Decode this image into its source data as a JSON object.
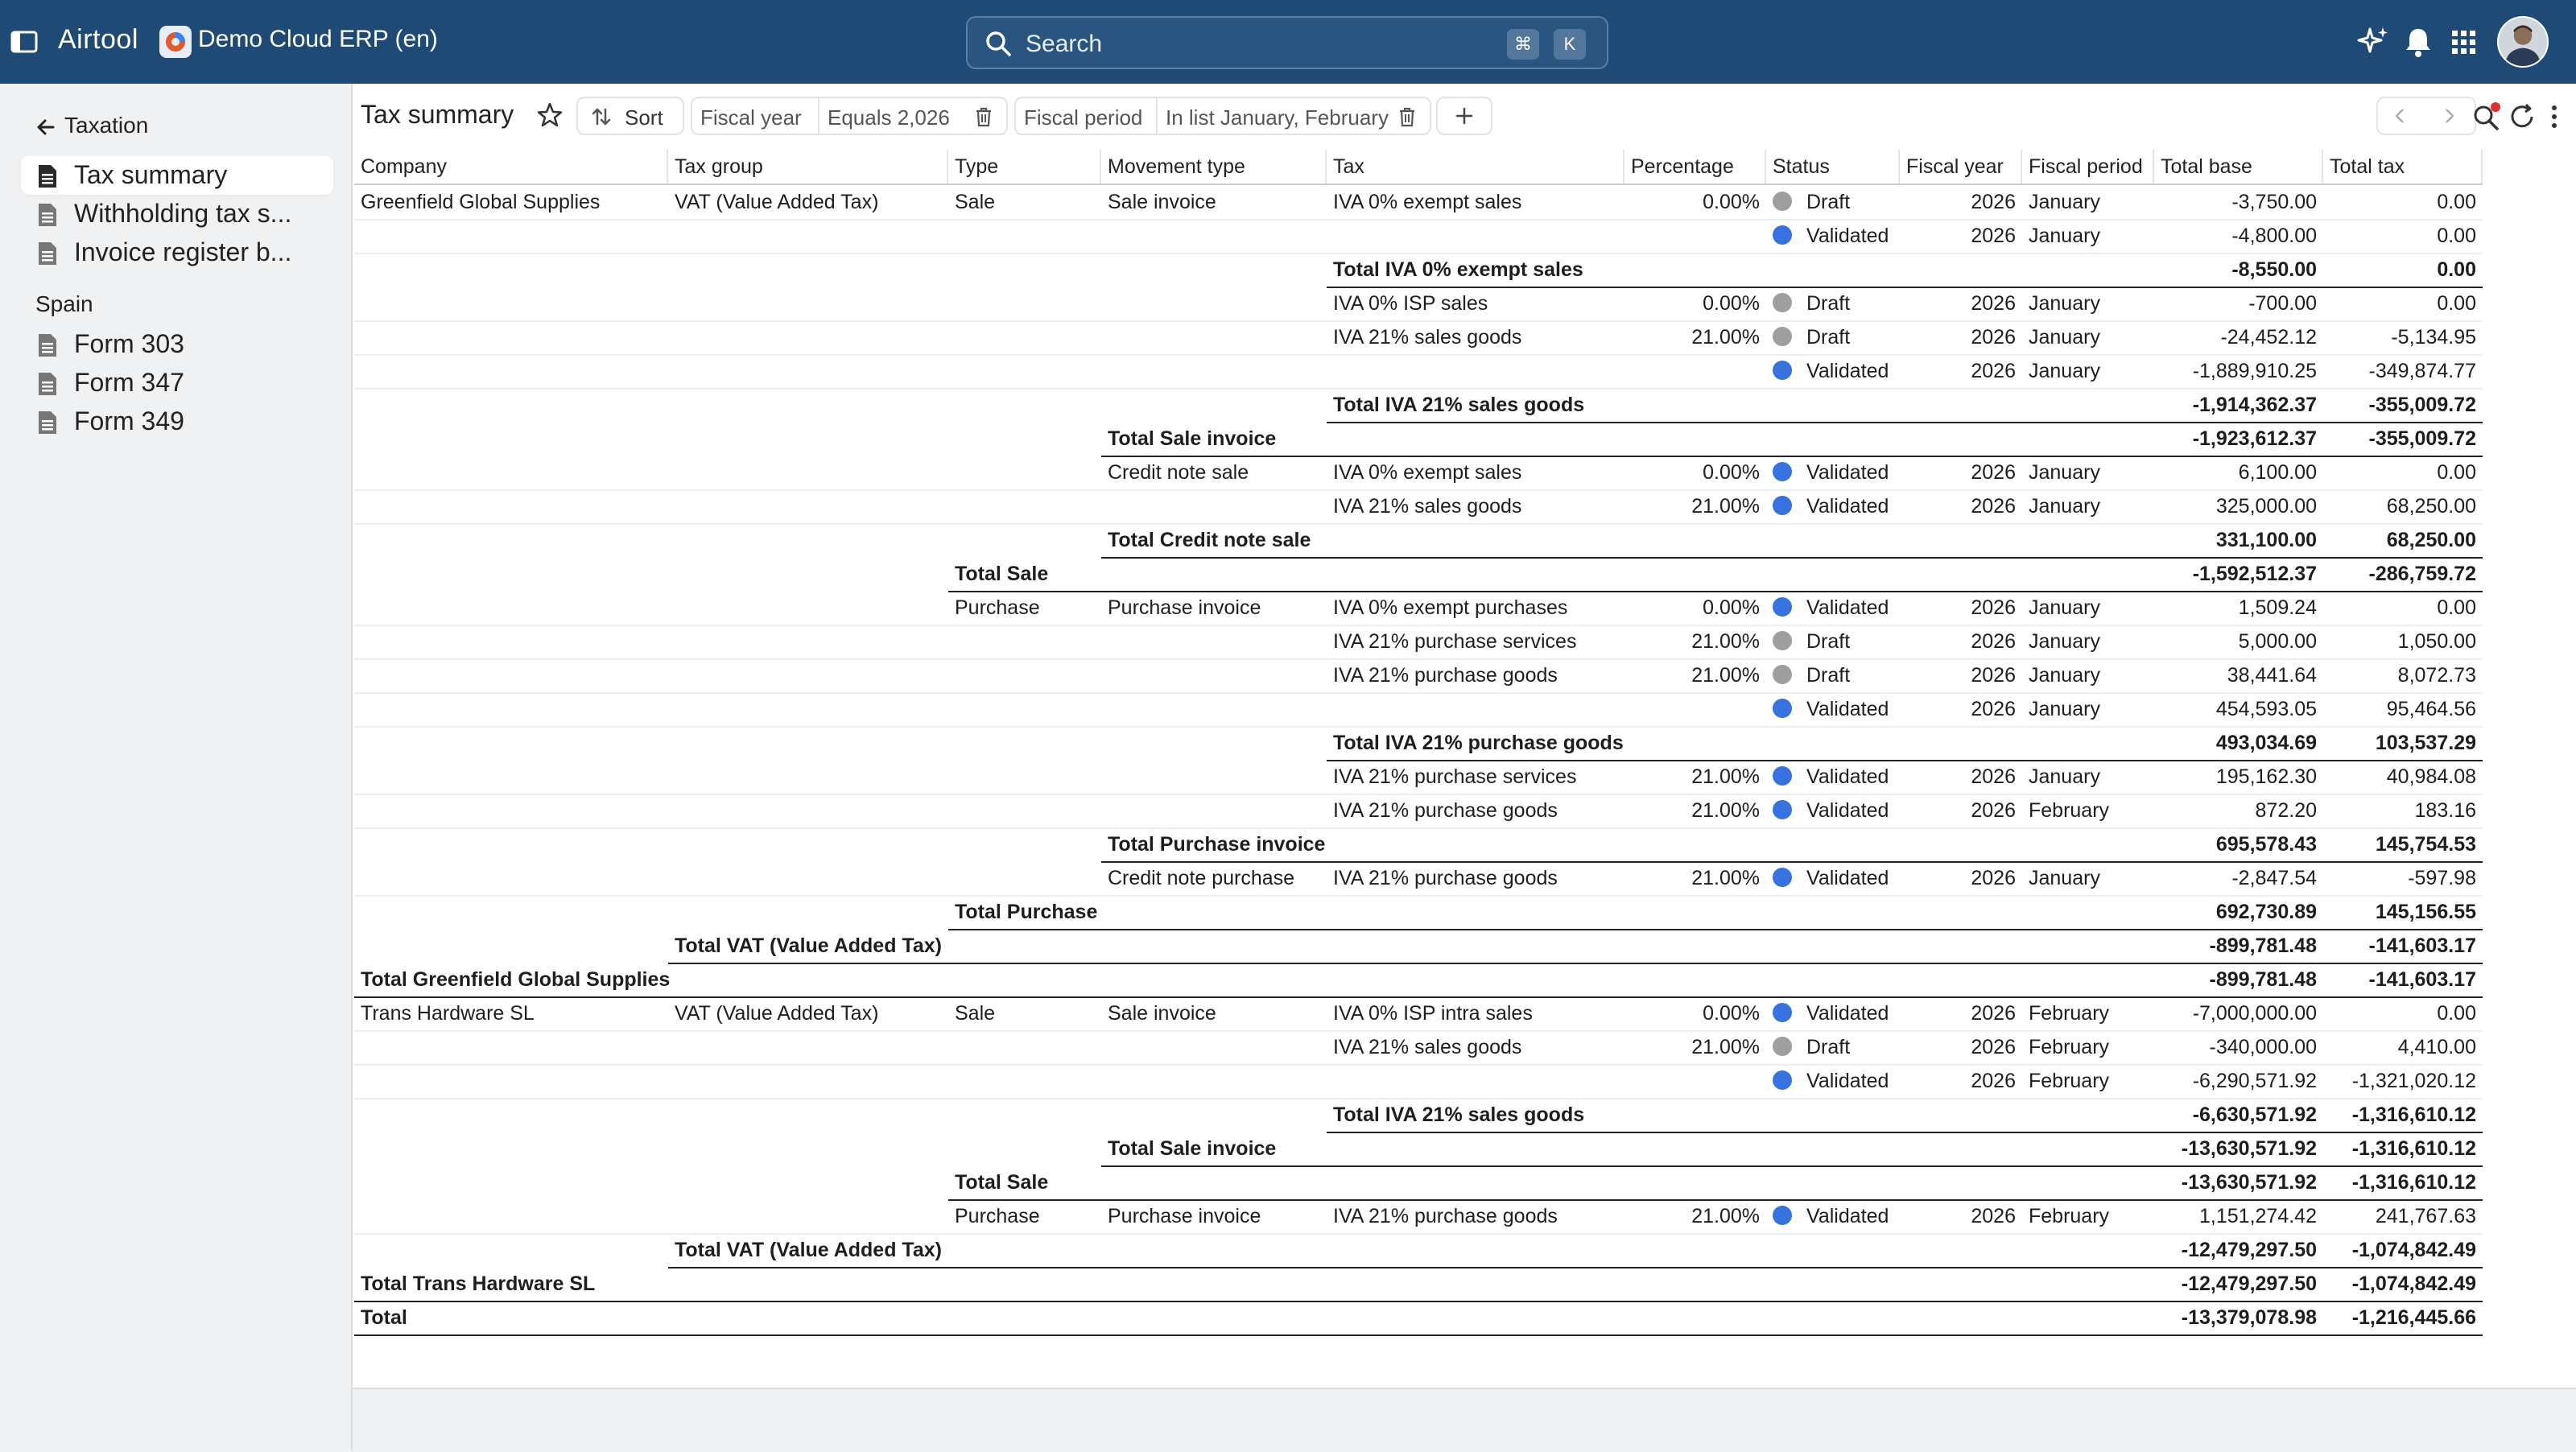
{
  "app": {
    "name": "Airtool",
    "company_name": "Demo Cloud ERP (en)"
  },
  "search": {
    "placeholder": "Search",
    "shortcut_keys": [
      "⌘",
      "K"
    ]
  },
  "sidebar": {
    "back_label": "Taxation",
    "items": [
      {
        "label": "Tax summary",
        "active": true
      },
      {
        "label": "Withholding tax s..."
      },
      {
        "label": "Invoice register b..."
      }
    ],
    "section": "Spain",
    "section_items": [
      {
        "label": "Form 303"
      },
      {
        "label": "Form 347"
      },
      {
        "label": "Form 349"
      }
    ]
  },
  "toolbar": {
    "title": "Tax summary",
    "sort_label": "Sort",
    "filters": [
      {
        "field": "Fiscal year",
        "condition": "Equals 2,026"
      },
      {
        "field": "Fiscal period",
        "condition": "In list January, February"
      }
    ]
  },
  "colors": {
    "topbar": "#1f4a75",
    "draft": "#9e9e9e",
    "validated": "#3871e0"
  },
  "table": {
    "columns": [
      "Company",
      "Tax group",
      "Type",
      "Movement type",
      "Tax",
      "Percentage",
      "Status",
      "Fiscal year",
      "Fiscal period",
      "Total base",
      "Total tax"
    ],
    "rows": [
      {
        "kind": "data",
        "company": "Greenfield Global Supplies",
        "tax_group": "VAT (Value Added Tax)",
        "type": "Sale",
        "movement": "Sale invoice",
        "tax": "IVA 0% exempt sales",
        "pct": "0.00%",
        "status": "Draft",
        "year": "2026",
        "period": "January",
        "base": "-3,750.00",
        "taxamt": "0.00"
      },
      {
        "kind": "data",
        "status": "Validated",
        "year": "2026",
        "period": "January",
        "base": "-4,800.00",
        "taxamt": "0.00"
      },
      {
        "kind": "total",
        "level": "tax",
        "label": "Total IVA 0% exempt sales",
        "base": "-8,550.00",
        "taxamt": "0.00"
      },
      {
        "kind": "data",
        "tax": "IVA 0% ISP sales",
        "pct": "0.00%",
        "status": "Draft",
        "year": "2026",
        "period": "January",
        "base": "-700.00",
        "taxamt": "0.00"
      },
      {
        "kind": "data",
        "tax": "IVA 21% sales goods",
        "pct": "21.00%",
        "status": "Draft",
        "year": "2026",
        "period": "January",
        "base": "-24,452.12",
        "taxamt": "-5,134.95"
      },
      {
        "kind": "data",
        "status": "Validated",
        "year": "2026",
        "period": "January",
        "base": "-1,889,910.25",
        "taxamt": "-349,874.77"
      },
      {
        "kind": "total",
        "level": "tax",
        "label": "Total IVA 21% sales goods",
        "base": "-1,914,362.37",
        "taxamt": "-355,009.72"
      },
      {
        "kind": "total",
        "level": "movement",
        "label": "Total Sale invoice",
        "base": "-1,923,612.37",
        "taxamt": "-355,009.72"
      },
      {
        "kind": "data",
        "movement": "Credit note sale",
        "tax": "IVA 0% exempt sales",
        "pct": "0.00%",
        "status": "Validated",
        "year": "2026",
        "period": "January",
        "base": "6,100.00",
        "taxamt": "0.00"
      },
      {
        "kind": "data",
        "tax": "IVA 21% sales goods",
        "pct": "21.00%",
        "status": "Validated",
        "year": "2026",
        "period": "January",
        "base": "325,000.00",
        "taxamt": "68,250.00"
      },
      {
        "kind": "total",
        "level": "movement",
        "label": "Total Credit note sale",
        "base": "331,100.00",
        "taxamt": "68,250.00"
      },
      {
        "kind": "total",
        "level": "type",
        "label": "Total Sale",
        "base": "-1,592,512.37",
        "taxamt": "-286,759.72"
      },
      {
        "kind": "data",
        "type": "Purchase",
        "movement": "Purchase invoice",
        "tax": "IVA 0% exempt purchases",
        "pct": "0.00%",
        "status": "Validated",
        "year": "2026",
        "period": "January",
        "base": "1,509.24",
        "taxamt": "0.00"
      },
      {
        "kind": "data",
        "tax": "IVA 21% purchase services",
        "pct": "21.00%",
        "status": "Draft",
        "year": "2026",
        "period": "January",
        "base": "5,000.00",
        "taxamt": "1,050.00"
      },
      {
        "kind": "data",
        "tax": "IVA 21% purchase goods",
        "pct": "21.00%",
        "status": "Draft",
        "year": "2026",
        "period": "January",
        "base": "38,441.64",
        "taxamt": "8,072.73"
      },
      {
        "kind": "data",
        "status": "Validated",
        "year": "2026",
        "period": "January",
        "base": "454,593.05",
        "taxamt": "95,464.56"
      },
      {
        "kind": "total",
        "level": "tax",
        "label": "Total IVA 21% purchase goods",
        "base": "493,034.69",
        "taxamt": "103,537.29"
      },
      {
        "kind": "data",
        "tax": "IVA 21% purchase services",
        "pct": "21.00%",
        "status": "Validated",
        "year": "2026",
        "period": "January",
        "base": "195,162.30",
        "taxamt": "40,984.08"
      },
      {
        "kind": "data",
        "tax": "IVA 21% purchase goods",
        "pct": "21.00%",
        "status": "Validated",
        "year": "2026",
        "period": "February",
        "base": "872.20",
        "taxamt": "183.16"
      },
      {
        "kind": "total",
        "level": "movement",
        "label": "Total Purchase invoice",
        "base": "695,578.43",
        "taxamt": "145,754.53"
      },
      {
        "kind": "data",
        "movement": "Credit note purchase",
        "tax": "IVA 21% purchase goods",
        "pct": "21.00%",
        "status": "Validated",
        "year": "2026",
        "period": "January",
        "base": "-2,847.54",
        "taxamt": "-597.98"
      },
      {
        "kind": "total",
        "level": "type",
        "label": "Total Purchase",
        "base": "692,730.89",
        "taxamt": "145,156.55"
      },
      {
        "kind": "total",
        "level": "group",
        "label": "Total VAT (Value Added Tax)",
        "base": "-899,781.48",
        "taxamt": "-141,603.17"
      },
      {
        "kind": "total",
        "level": "company",
        "label": "Total Greenfield Global Supplies",
        "base": "-899,781.48",
        "taxamt": "-141,603.17"
      },
      {
        "kind": "data",
        "company": "Trans Hardware SL",
        "tax_group": "VAT (Value Added Tax)",
        "type": "Sale",
        "movement": "Sale invoice",
        "tax": "IVA 0% ISP intra sales",
        "pct": "0.00%",
        "status": "Validated",
        "year": "2026",
        "period": "February",
        "base": "-7,000,000.00",
        "taxamt": "0.00"
      },
      {
        "kind": "data",
        "tax": "IVA 21% sales goods",
        "pct": "21.00%",
        "status": "Draft",
        "year": "2026",
        "period": "February",
        "base": "-340,000.00",
        "taxamt": "4,410.00"
      },
      {
        "kind": "data",
        "status": "Validated",
        "year": "2026",
        "period": "February",
        "base": "-6,290,571.92",
        "taxamt": "-1,321,020.12"
      },
      {
        "kind": "total",
        "level": "tax",
        "label": "Total IVA 21% sales goods",
        "base": "-6,630,571.92",
        "taxamt": "-1,316,610.12"
      },
      {
        "kind": "total",
        "level": "movement",
        "label": "Total Sale invoice",
        "base": "-13,630,571.92",
        "taxamt": "-1,316,610.12"
      },
      {
        "kind": "total",
        "level": "type",
        "label": "Total Sale",
        "base": "-13,630,571.92",
        "taxamt": "-1,316,610.12"
      },
      {
        "kind": "data",
        "type": "Purchase",
        "movement": "Purchase invoice",
        "tax": "IVA 21% purchase goods",
        "pct": "21.00%",
        "status": "Validated",
        "year": "2026",
        "period": "February",
        "base": "1,151,274.42",
        "taxamt": "241,767.63"
      },
      {
        "kind": "total",
        "level": "group",
        "label": "Total VAT (Value Added Tax)",
        "base": "-12,479,297.50",
        "taxamt": "-1,074,842.49"
      },
      {
        "kind": "total",
        "level": "company",
        "label": "Total Trans Hardware SL",
        "base": "-12,479,297.50",
        "taxamt": "-1,074,842.49"
      },
      {
        "kind": "total",
        "level": "grand",
        "label": "Total",
        "base": "-13,379,078.98",
        "taxamt": "-1,216,445.66"
      }
    ]
  }
}
